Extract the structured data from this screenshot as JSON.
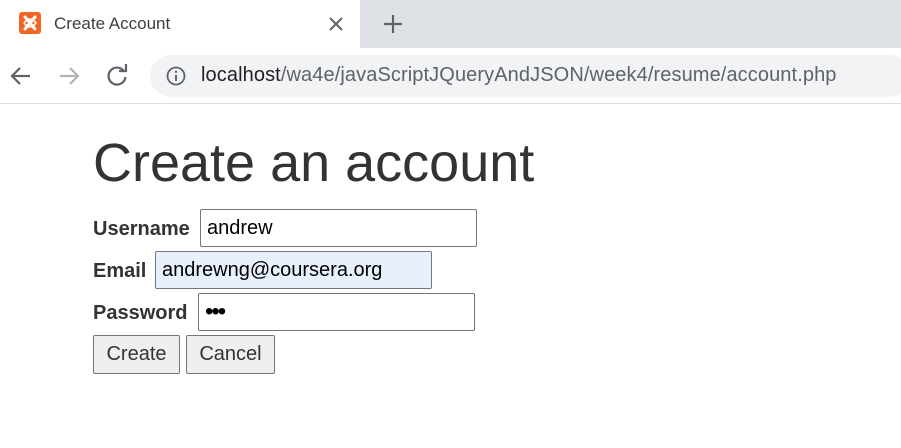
{
  "browser": {
    "tab": {
      "title": "Create Account",
      "favicon": "xampp-icon",
      "close_icon": "close-icon"
    },
    "new_tab_icon": "plus-icon",
    "nav": {
      "back_icon": "arrow-left-icon",
      "forward_icon": "arrow-right-icon",
      "reload_icon": "reload-icon"
    },
    "address": {
      "info_icon": "info-icon",
      "host": "localhost",
      "path": "/wa4e/javaScriptJQueryAndJSON/week4/resume/account.php"
    }
  },
  "page": {
    "title": "Create an account",
    "form": {
      "username": {
        "label": "Username",
        "value": "andrew"
      },
      "email": {
        "label": "Email",
        "value": "andrewng@coursera.org"
      },
      "password": {
        "label": "Password",
        "value": "abc"
      },
      "create_label": "Create",
      "cancel_label": "Cancel"
    }
  },
  "colors": {
    "favicon": "#f26522",
    "tabstrip": "#dee1e6",
    "omnibox": "#f1f3f4",
    "autofill": "#e8f0fe"
  }
}
